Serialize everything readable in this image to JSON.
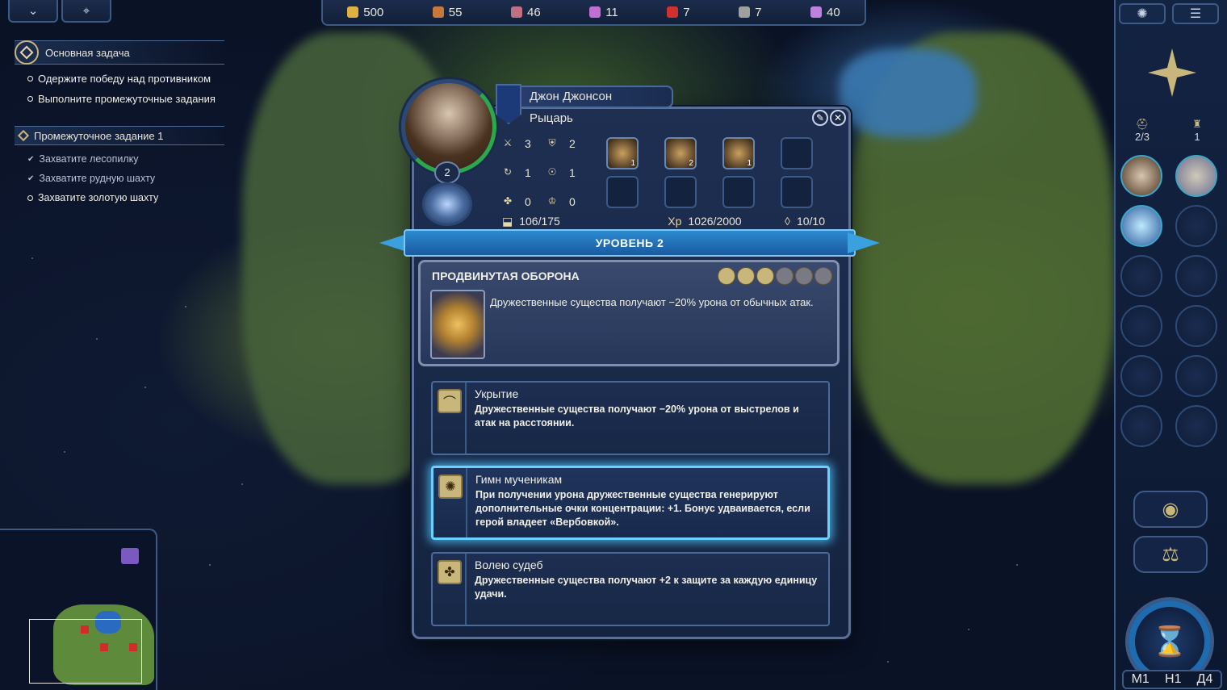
{
  "top_left": {
    "collapse_icon": "chevron-down-icon",
    "map_icon": "map-pin-icon"
  },
  "resources": [
    {
      "icon": "gold-icon",
      "value": "500",
      "color": "#e0b040"
    },
    {
      "icon": "wood-icon",
      "value": "55",
      "color": "#c8783a"
    },
    {
      "icon": "ore-icon",
      "value": "46",
      "color": "#c07080"
    },
    {
      "icon": "crystal-icon",
      "value": "11",
      "color": "#c070d0"
    },
    {
      "icon": "gem-icon",
      "value": "7",
      "color": "#d03030"
    },
    {
      "icon": "mercury-icon",
      "value": "7",
      "color": "#a0a0a0"
    },
    {
      "icon": "dust-icon",
      "value": "40",
      "color": "#c080e0"
    }
  ],
  "quests": {
    "main_title": "Основная задача",
    "main_items": [
      "Одержите победу над противником",
      "Выполните промежуточные задания"
    ],
    "sub_title": "Промежуточное задание 1",
    "sub_items": [
      {
        "text": "Захватите лесопилку",
        "done": true
      },
      {
        "text": "Захватите рудную шахту",
        "done": true
      },
      {
        "text": "Захватите золотую шахту",
        "done": false
      }
    ]
  },
  "hero": {
    "name": "Джон Джонсон",
    "class": "Рыцарь",
    "level": "2",
    "stats": [
      {
        "icon": "attack-icon",
        "value": "3"
      },
      {
        "icon": "defense-icon",
        "value": "2"
      },
      {
        "icon": "spellpower-icon",
        "value": "1"
      },
      {
        "icon": "knowledge-icon",
        "value": "1"
      },
      {
        "icon": "luck-icon",
        "value": "0"
      },
      {
        "icon": "morale-icon",
        "value": "0"
      }
    ],
    "artifacts": [
      {
        "count": "1"
      },
      {
        "count": "2"
      },
      {
        "count": "1"
      },
      {
        "count": ""
      },
      {
        "count": ""
      },
      {
        "count": ""
      },
      {
        "count": ""
      },
      {
        "count": ""
      }
    ],
    "movement": "106/175",
    "xp_label": "Xp",
    "xp": "1026/2000",
    "mana": "10/10"
  },
  "level_banner": "УРОВЕНЬ 2",
  "current_skill": {
    "title": "ПРОДВИНУТАЯ ОБОРОНА",
    "description": "Дружественные существа получают −20% урона от обычных атак."
  },
  "skill_options": [
    {
      "title": "Укрытие",
      "description": "Дружественные существа получают −20% урона от выстрелов и атак на расстоянии.",
      "icon": "shelter-icon",
      "selected": false
    },
    {
      "title": "Гимн мученикам",
      "description": "При получении урона дружественные существа генерируют дополнительные очки концентрации: +1. Бонус удваивается, если герой владеет «Вербовкой».",
      "icon": "hymn-icon",
      "selected": true
    },
    {
      "title": "Волею судеб",
      "description": "Дружественные существа получают +2 к защите за каждую единицу удачи.",
      "icon": "fate-icon",
      "selected": false
    }
  ],
  "right_panel": {
    "heroes_count": "2/3",
    "towns_count": "1",
    "date": [
      "М1",
      "Н1",
      "Д4"
    ]
  }
}
